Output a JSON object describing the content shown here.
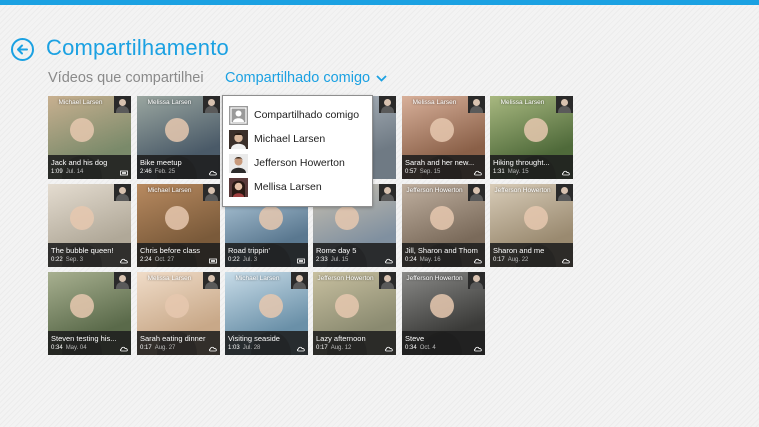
{
  "app": {
    "title": "Compartilhamento",
    "accent": "#1ba1e2"
  },
  "subnav": {
    "left_label": "Vídeos que compartilhei",
    "right_label": "Compartilhado comigo"
  },
  "dropdown": {
    "items": [
      {
        "label": "Compartilhado comigo",
        "icon": "generic-user-icon"
      },
      {
        "label": "Michael Larsen",
        "icon": "avatar"
      },
      {
        "label": "Jefferson Howerton",
        "icon": "avatar"
      },
      {
        "label": "Mellisa Larsen",
        "icon": "avatar"
      }
    ]
  },
  "videos": [
    {
      "owner": "Michael Larsen",
      "title": "Jack and his dog",
      "duration": "1:09",
      "date": "Jul. 14",
      "icon": "film-icon"
    },
    {
      "owner": "Melissa Larsen",
      "title": "Bike meetup",
      "duration": "2:46",
      "date": "Feb. 25",
      "icon": "cloud-icon"
    },
    {
      "owner": "",
      "title": "",
      "duration": "",
      "date": "",
      "icon": "film-icon"
    },
    {
      "owner": "",
      "title": "",
      "duration": "",
      "date": "",
      "icon": "film-icon"
    },
    {
      "owner": "Melissa Larsen",
      "title": "Sarah and her new...",
      "duration": "0:57",
      "date": "Sep. 15",
      "icon": "cloud-icon"
    },
    {
      "owner": "Melissa Larsen",
      "title": "Hiking throught...",
      "duration": "1:31",
      "date": "May. 15",
      "icon": "cloud-icon"
    },
    {
      "owner": "",
      "title": "The bubble queen!",
      "duration": "0:22",
      "date": "Sep. 3",
      "icon": "cloud-icon"
    },
    {
      "owner": "Michael Larsen",
      "title": "Chris before class",
      "duration": "2:24",
      "date": "Oct. 27",
      "icon": "film-icon"
    },
    {
      "owner": "",
      "title": "Road trippin'",
      "duration": "0:22",
      "date": "Jul. 3",
      "icon": "film-icon"
    },
    {
      "owner": "Michael Larsen",
      "title": "Rome day 5",
      "duration": "2:33",
      "date": "Jul. 15",
      "icon": "cloud-icon"
    },
    {
      "owner": "Jefferson Howerton",
      "title": "Jill, Sharon and Thom",
      "duration": "0:24",
      "date": "May. 16",
      "icon": "cloud-icon"
    },
    {
      "owner": "Jefferson Howerton",
      "title": "Sharon and me",
      "duration": "0:17",
      "date": "Aug. 22",
      "icon": "cloud-icon"
    },
    {
      "owner": "",
      "title": "Steven testing his...",
      "duration": "0:34",
      "date": "May. 04",
      "icon": "cloud-icon"
    },
    {
      "owner": "Melissa Larsen",
      "title": "Sarah eating dinner",
      "duration": "0:17",
      "date": "Aug. 27",
      "icon": "cloud-icon"
    },
    {
      "owner": "Michael Larsen",
      "title": "Visiting seaside",
      "duration": "1:03",
      "date": "Jul. 28",
      "icon": "cloud-icon"
    },
    {
      "owner": "Jefferson Howerton",
      "title": "Lazy afternoon",
      "duration": "0:17",
      "date": "Aug. 12",
      "icon": "cloud-icon"
    },
    {
      "owner": "Jefferson Howerton",
      "title": "Steve",
      "duration": "0:34",
      "date": "Oct. 4",
      "icon": "cloud-icon"
    }
  ]
}
